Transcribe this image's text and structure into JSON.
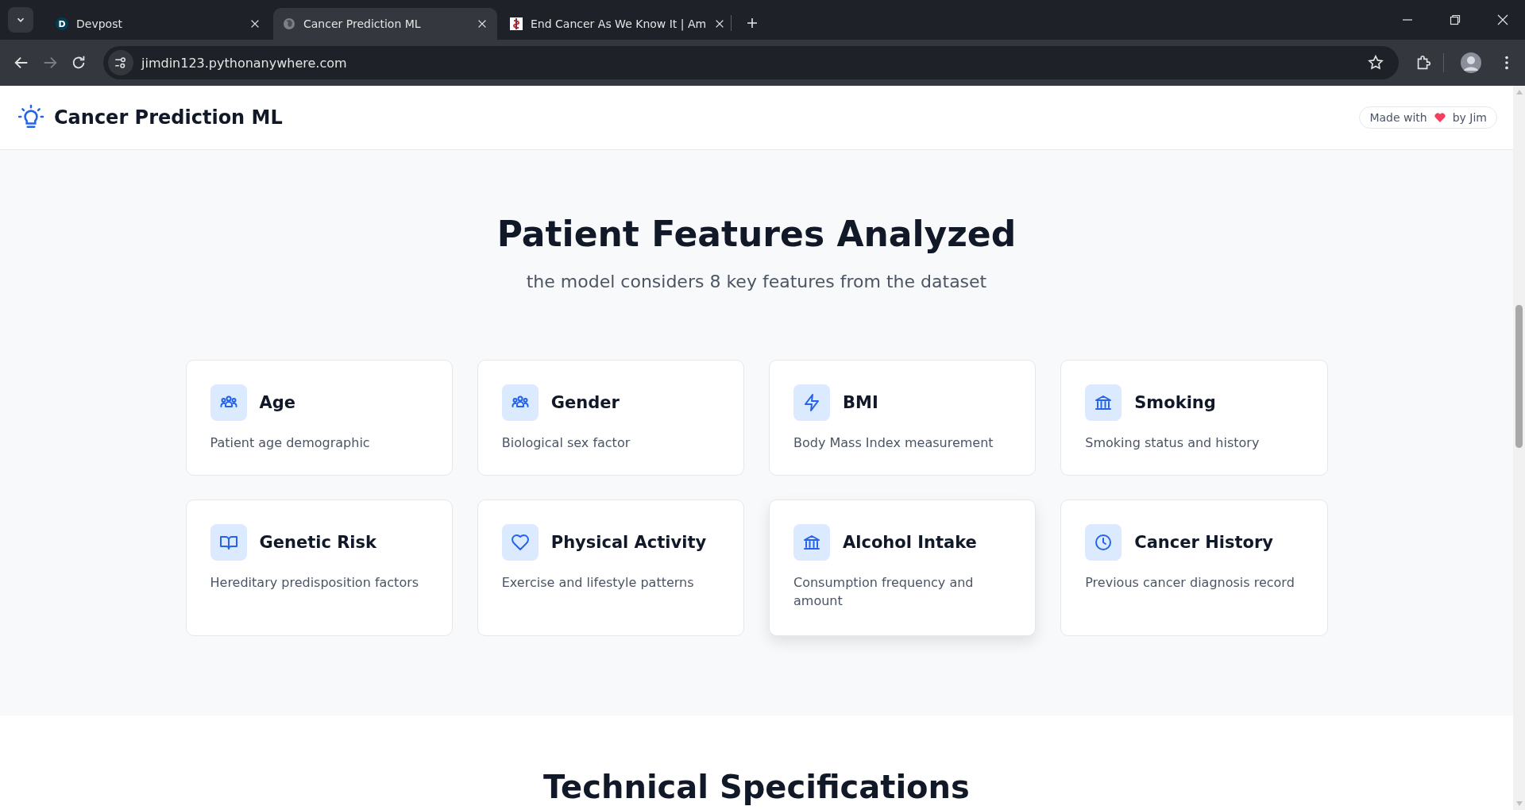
{
  "browser": {
    "tabs": [
      {
        "title": "Devpost",
        "selected": false,
        "kind": "letter",
        "favicon_text": "D"
      },
      {
        "title": "Cancer Prediction ML",
        "selected": true,
        "kind": "globe"
      },
      {
        "title": "End Cancer As We Know It | Am",
        "selected": false,
        "kind": "emblem"
      }
    ],
    "url": "jimdin123.pythonanywhere.com"
  },
  "header": {
    "brand": "Cancer Prediction ML",
    "badge_prefix": "Made with",
    "badge_suffix": "by Jim"
  },
  "features_section": {
    "title": "Patient Features Analyzed",
    "subtitle": "the model considers 8 key features from the dataset",
    "features": [
      {
        "title": "Age",
        "description": "Patient age demographic",
        "kind": "people",
        "highlighted": false
      },
      {
        "title": "Gender",
        "description": "Biological sex factor",
        "kind": "people",
        "highlighted": false
      },
      {
        "title": "BMI",
        "description": "Body Mass Index measurement",
        "kind": "bolt",
        "highlighted": false
      },
      {
        "title": "Smoking",
        "description": "Smoking status and history",
        "kind": "bank",
        "highlighted": false
      },
      {
        "title": "Genetic Risk",
        "description": "Hereditary predisposition factors",
        "kind": "book",
        "highlighted": false
      },
      {
        "title": "Physical Activity",
        "description": "Exercise and lifestyle patterns",
        "kind": "heart",
        "highlighted": false
      },
      {
        "title": "Alcohol Intake",
        "description": "Consumption frequency and amount",
        "kind": "bank",
        "highlighted": true
      },
      {
        "title": "Cancer History",
        "description": "Previous cancer diagnosis record",
        "kind": "clock",
        "highlighted": false
      }
    ]
  },
  "next_section": {
    "title": "Technical Specifications"
  }
}
